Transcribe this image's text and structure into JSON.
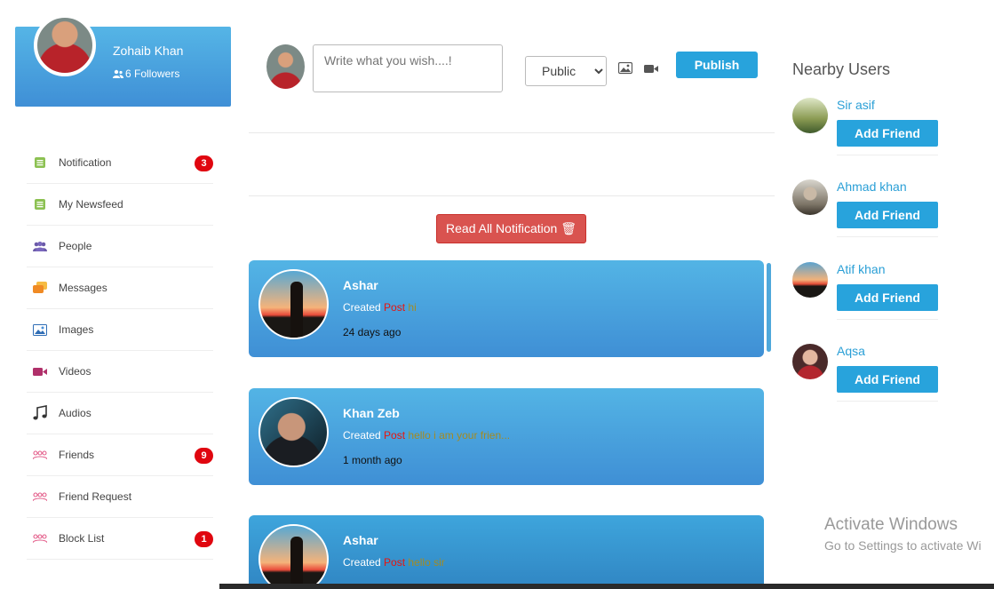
{
  "profile": {
    "name": "Zohaib Khan",
    "followers": "6 Followers"
  },
  "sidebar": {
    "items": [
      {
        "label": "Notification",
        "badge": "3",
        "icon": "notification-icon"
      },
      {
        "label": "My Newsfeed",
        "badge": "",
        "icon": "newsfeed-icon"
      },
      {
        "label": "People",
        "badge": "",
        "icon": "people-icon"
      },
      {
        "label": "Messages",
        "badge": "",
        "icon": "messages-icon"
      },
      {
        "label": "Images",
        "badge": "",
        "icon": "images-icon"
      },
      {
        "label": "Videos",
        "badge": "",
        "icon": "videos-icon"
      },
      {
        "label": "Audios",
        "badge": "",
        "icon": "music-note-icon"
      },
      {
        "label": "Friends",
        "badge": "9",
        "icon": "friends-icon"
      },
      {
        "label": "Friend Request",
        "badge": "",
        "icon": "friend-request-icon"
      },
      {
        "label": "Block List",
        "badge": "1",
        "icon": "block-list-icon"
      }
    ]
  },
  "composer": {
    "placeholder": "Write what you wish....!",
    "privacy": "Public",
    "publish_label": "Publish"
  },
  "notifications": {
    "read_all_label": "Read All Notification 🗑",
    "items": [
      {
        "name": "Ashar",
        "action": "Created",
        "type": "Post",
        "snippet": "hi",
        "time": "24 days ago"
      },
      {
        "name": "Khan Zeb",
        "action": "Created",
        "type": "Post",
        "snippet": "hello i am your frien...",
        "time": "1 month ago"
      },
      {
        "name": "Ashar",
        "action": "Created",
        "type": "Post",
        "snippet": "hello sir",
        "time": ""
      }
    ]
  },
  "nearby": {
    "title": "Nearby Users",
    "add_label": "Add Friend",
    "users": [
      {
        "name": "Sir asif"
      },
      {
        "name": "Ahmad khan"
      },
      {
        "name": "Atif khan"
      },
      {
        "name": "Aqsa"
      }
    ]
  },
  "watermark": {
    "title": "Activate Windows",
    "subtitle": "Go to Settings to activate Wi"
  },
  "colors": {
    "accent": "#28a3dc",
    "danger": "#d9534f",
    "badge": "#e0060f"
  }
}
